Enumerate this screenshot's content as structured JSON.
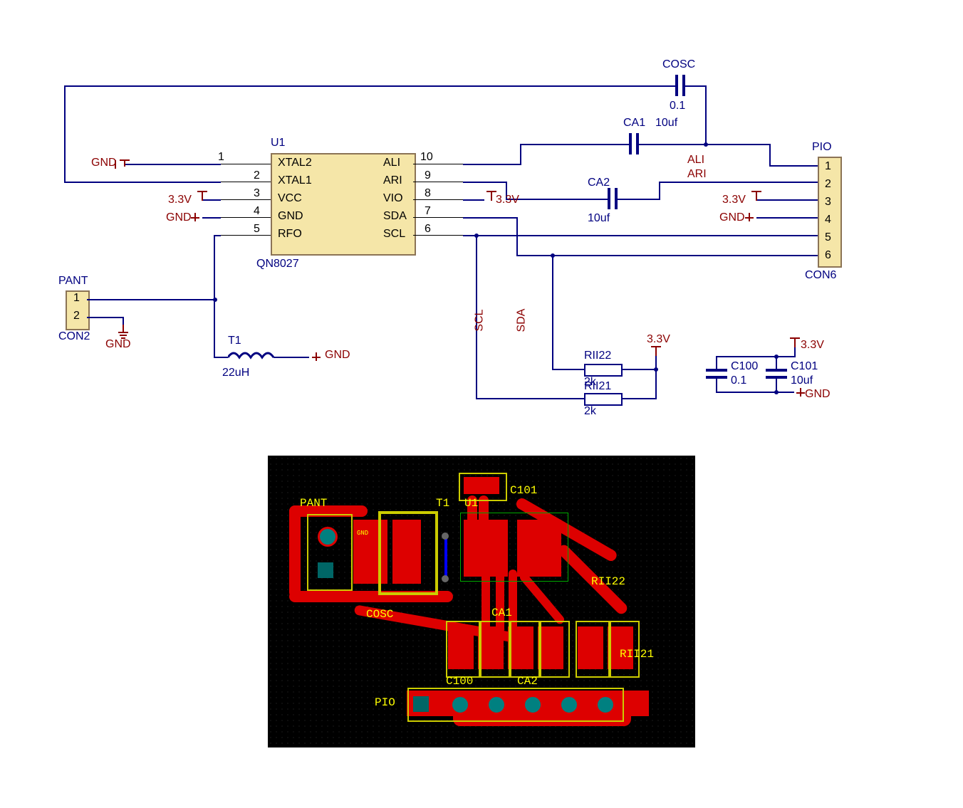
{
  "schematic": {
    "u1": {
      "ref": "U1",
      "part": "QN8027",
      "pins_left": {
        "1": "XTAL2",
        "2": "XTAL1",
        "3": "VCC",
        "4": "GND",
        "5": "RFO"
      },
      "pins_right": {
        "10": "ALI",
        "9": "ARI",
        "8": "VIO",
        "7": "SDA",
        "6": "SCL"
      }
    },
    "cosc": {
      "ref": "COSC",
      "value": "0.1"
    },
    "ca1": {
      "ref": "CA1",
      "value": "10uf"
    },
    "ca2": {
      "ref": "CA2",
      "value": "10uf"
    },
    "c100": {
      "ref": "C100",
      "value": "0.1"
    },
    "c101": {
      "ref": "C101",
      "value": "10uf"
    },
    "rii22": {
      "ref": "RII22",
      "value": "2k"
    },
    "rii21": {
      "ref": "RII21",
      "value": "2k"
    },
    "t1": {
      "ref": "T1",
      "value": "22uH"
    },
    "pant": {
      "ref": "PANT",
      "type": "CON2",
      "pins": [
        "1",
        "2"
      ]
    },
    "pio": {
      "ref": "PIO",
      "type": "CON6",
      "pins": [
        "1",
        "2",
        "3",
        "4",
        "5",
        "6"
      ]
    },
    "nets": {
      "ali": "ALI",
      "ari": "ARI",
      "scl": "SCL",
      "sda": "SDA"
    },
    "power": {
      "v33": "3.3V",
      "gnd": "GND"
    }
  },
  "pcb": {
    "labels": {
      "pant": "PANT",
      "t1": "T1",
      "u1": "U1",
      "c101": "C101",
      "gnd": "GND",
      "cosc": "COSC",
      "c100": "C100",
      "ca1": "CA1",
      "ca2": "CA2",
      "rii22": "RII22",
      "rii21": "RII21",
      "pio": "PIO"
    }
  }
}
